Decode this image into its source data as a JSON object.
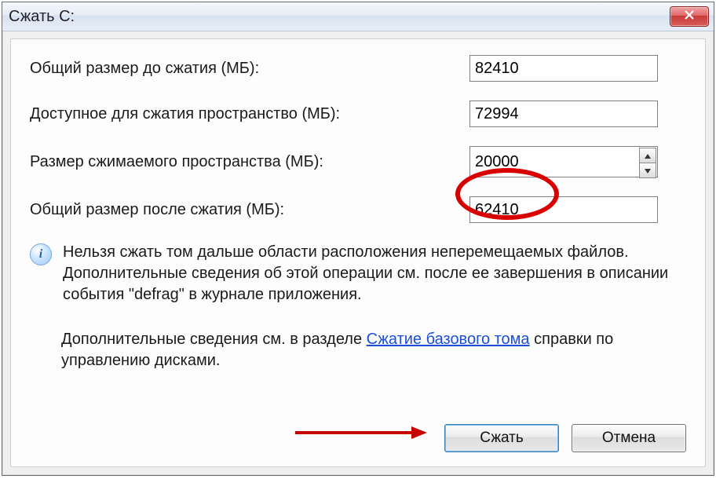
{
  "window": {
    "title": "Сжать C:"
  },
  "fields": {
    "total_before": {
      "label": "Общий размер до сжатия (МБ):",
      "value": "82410"
    },
    "available": {
      "label": "Доступное для сжатия пространство (МБ):",
      "value": "72994"
    },
    "shrink_amount": {
      "label": "Размер сжимаемого пространства (МБ):",
      "value": "20000"
    },
    "total_after": {
      "label": "Общий размер после сжатия (МБ):",
      "value": "62410"
    }
  },
  "info": {
    "text": "Нельзя сжать том дальше области расположения неперемещаемых файлов. Дополнительные сведения об этой операции см. после ее завершения в описании события \"defrag\" в журнале приложения."
  },
  "help": {
    "prefix": "Дополнительные сведения см. в разделе ",
    "link": "Сжатие базового тома",
    "suffix": " справки по управлению дисками."
  },
  "buttons": {
    "shrink": "Сжать",
    "cancel": "Отмена"
  }
}
